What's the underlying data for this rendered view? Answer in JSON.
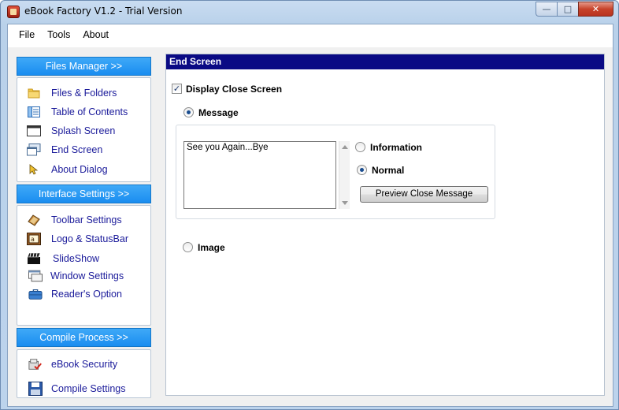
{
  "window": {
    "title": "eBook Factory  V1.2 - Trial Version"
  },
  "menu": [
    "File",
    "Tools",
    "About"
  ],
  "sidebar": {
    "sections": [
      {
        "header": "Files Manager >>",
        "items": [
          {
            "label": "Files & Folders",
            "icon": "folder-icon"
          },
          {
            "label": "Table of Contents",
            "icon": "toc-icon"
          },
          {
            "label": "Splash Screen",
            "icon": "splash-screen-icon"
          },
          {
            "label": "End Screen",
            "icon": "end-screen-icon"
          },
          {
            "label": "About Dialog",
            "icon": "pointer-icon"
          }
        ]
      },
      {
        "header": "Interface Settings >>",
        "items": [
          {
            "label": "Toolbar Settings",
            "icon": "toolbar-icon"
          },
          {
            "label": "Logo & StatusBar",
            "icon": "logo-icon"
          },
          {
            "label": "SlideShow",
            "icon": "clapperboard-icon"
          },
          {
            "label": "Window Settings",
            "icon": "window-icon"
          },
          {
            "label": "Reader's Option",
            "icon": "briefcase-icon"
          }
        ]
      },
      {
        "header": "Compile Process >>",
        "items": [
          {
            "label": "eBook Security",
            "icon": "security-icon"
          },
          {
            "label": "Compile Settings",
            "icon": "floppy-disk-icon"
          }
        ]
      }
    ]
  },
  "main": {
    "title": "End Screen",
    "display_close_label": "Display Close Screen",
    "display_close_checked": true,
    "message_label": "Message",
    "message_selected": true,
    "message_text": "See you Again...Bye",
    "information_label": "Information",
    "normal_label": "Normal",
    "normal_selected": true,
    "preview_button": "Preview Close Message",
    "image_label": "Image"
  }
}
